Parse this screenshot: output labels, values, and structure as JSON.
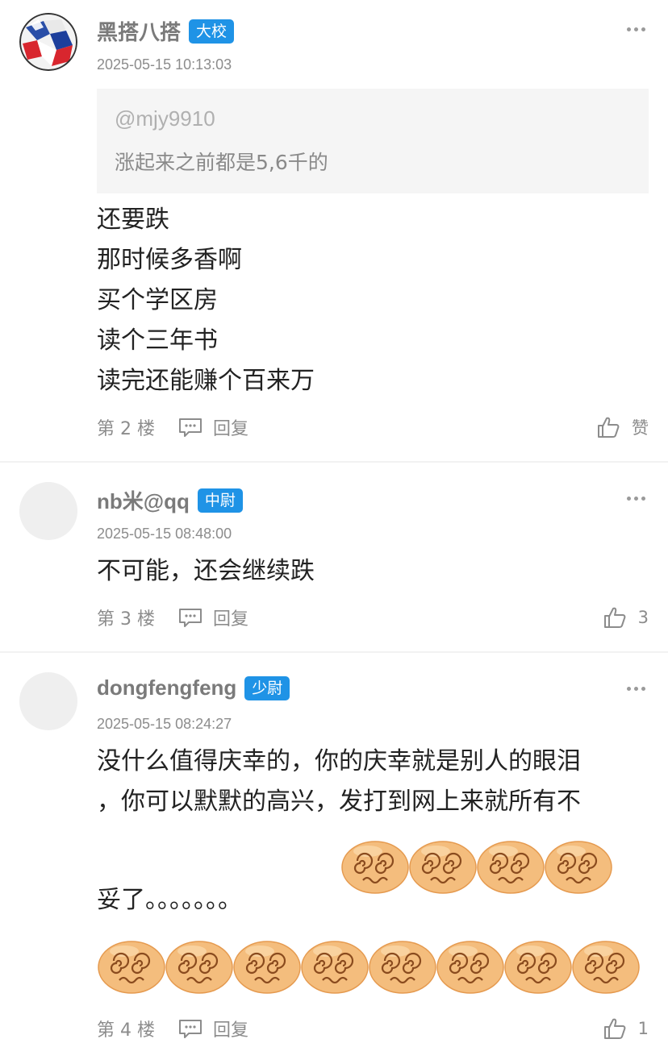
{
  "posts": [
    {
      "username": "黑搭八搭",
      "rank": "大校",
      "time": "2025-05-15 10:13:03",
      "quote": {
        "user": "@mjy9910",
        "text": "涨起来之前都是5,6千的"
      },
      "lines": [
        "还要跌",
        "那时候多香啊",
        "买个学区房",
        "读个三年书",
        "读完还能赚个百来万"
      ],
      "floor": "第 2 楼",
      "reply": "回复",
      "like": "赞"
    },
    {
      "username": "nb米@qq",
      "rank": "中尉",
      "time": "2025-05-15 08:48:00",
      "text": "不可能，还会继续跌",
      "floor": "第 3 楼",
      "reply": "回复",
      "like": "3"
    },
    {
      "username": "dongfengfeng",
      "rank": "少尉",
      "time": "2025-05-15 08:24:27",
      "text_line1": "没什么值得庆幸的，你的庆幸就是别人的眼泪",
      "text_line2": "，你可以默默的高兴，发打到网上来就所有不",
      "text_line3": "妥了。。。。。。。",
      "emoji_name": "dizzy-face-emoji",
      "emoji_row1_count": 4,
      "emoji_row2_count": 8,
      "floor": "第 4 楼",
      "reply": "回复",
      "like": "1"
    }
  ],
  "colors": {
    "badge": "#1f93e6",
    "emoji": "#f4bd7d"
  }
}
